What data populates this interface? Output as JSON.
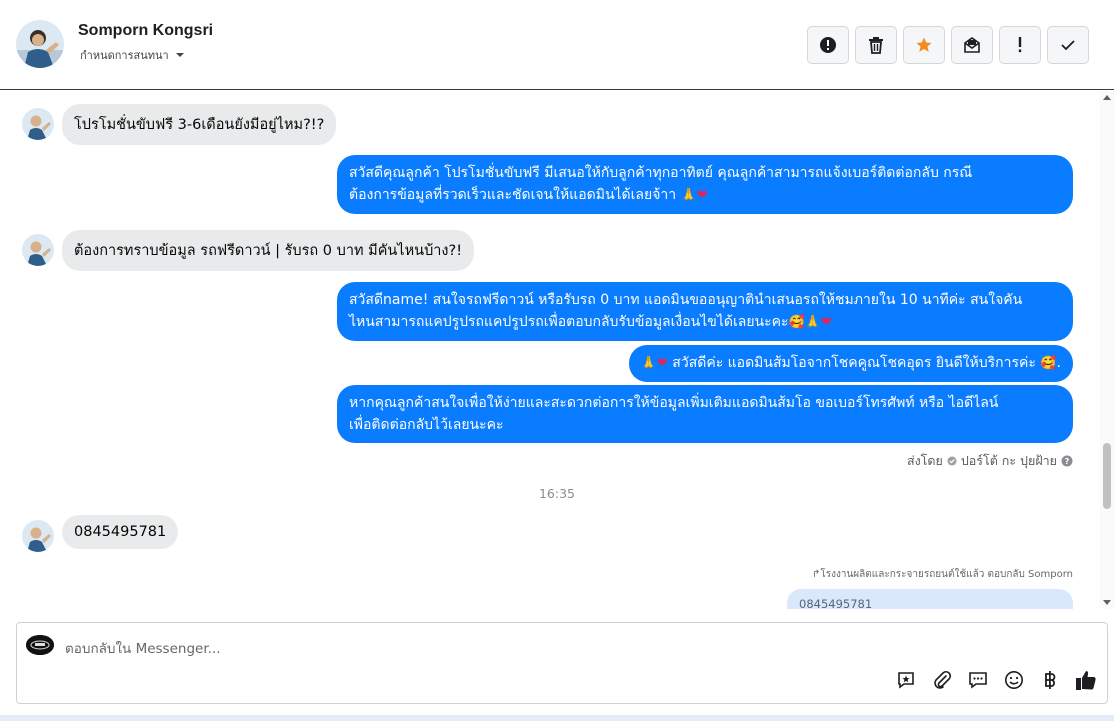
{
  "header": {
    "contact_name": "Somporn Kongsri",
    "assign_label": "กำหนดการสนทนา",
    "actions": [
      {
        "icon": "alert-circle-icon",
        "label": "spam"
      },
      {
        "icon": "trash-icon",
        "label": "delete"
      },
      {
        "icon": "star-icon",
        "label": "star",
        "color": "#f28b20"
      },
      {
        "icon": "mark-unread-icon",
        "label": "unread"
      },
      {
        "icon": "exclamation-icon",
        "label": "follow-up"
      },
      {
        "icon": "check-icon",
        "label": "done"
      }
    ]
  },
  "messages": [
    {
      "direction": "in",
      "text": "โปรโมชั่นขับฟรี 3-6เดือนยังมีอยู่ไหม?!?"
    },
    {
      "direction": "out",
      "line1": "สวัสดีคุณลูกค้า โปรโมชั่นขับฟรี มีเสนอให้กับลูกค้าทุกอาทิตย์ คุณลูกค้าสามารถแจ้งเบอร์ติดต่อกลับ กรณี",
      "line2": "ต้องการข้อมูลที่รวดเร็วและชัดเจนให้แอดมินได้เลยจ้าา"
    },
    {
      "direction": "in",
      "text": "ต้องการทราบข้อมูล รถฟรีดาวน์ | รับรถ 0 บาท มีคันไหนบ้าง?!"
    },
    {
      "direction": "out",
      "line1": "สวัสดีname! สนใจรถฟรีดาวน์ หรือรับรถ 0 บาท แอดมินขออนุญาตินำเสนอรถให้ชมภายใน 10 นาทีค่ะ สนใจคัน",
      "line2": "ไหนสามารถแคปรูปรถแคปรูปรถเพื่อตอบกลับรับข้อมูลเงื่อนไขได้เลยนะคะ"
    },
    {
      "direction": "out",
      "text": "สวัสดีค่ะ แอดมินส้มโอจากโชคคูณโชคอุดร ยินดีให้บริการค่ะ"
    },
    {
      "direction": "out",
      "line1": "หากคุณลูกค้าสนใจเพื่อให้ง่ายและสะดวกต่อการให้ข้อมูลเพิ่มเติมแอดมินส้มโอ ขอเบอร์โทรศัพท์ หรือ ไอดีไลน์",
      "line2": "เพื่อติดต่อกลับไว้เลยนะคะ"
    },
    {
      "direction": "in",
      "text": "0845495781"
    }
  ],
  "sender_line": {
    "prefix": "ส่งโดย",
    "name": "ปอร์โต้ กะ ปุยฝ้าย"
  },
  "timestamp": "16:35",
  "reply_note": "โรงงานผลิตและกระจายรถยนต์ใช้แล้ว ตอบกลับ Somporn",
  "reply_quote": "0845495781",
  "composer": {
    "placeholder": "ตอบกลับใน Messenger...",
    "tools": [
      "saved-reply-icon",
      "attachment-icon",
      "chat-bubbles-icon",
      "emoji-icon",
      "baht-icon",
      "thumbs-up-icon"
    ]
  },
  "colors": {
    "outgoing": "#0a7cff",
    "incoming": "#e9eaeb",
    "accent_star": "#f28b20"
  }
}
